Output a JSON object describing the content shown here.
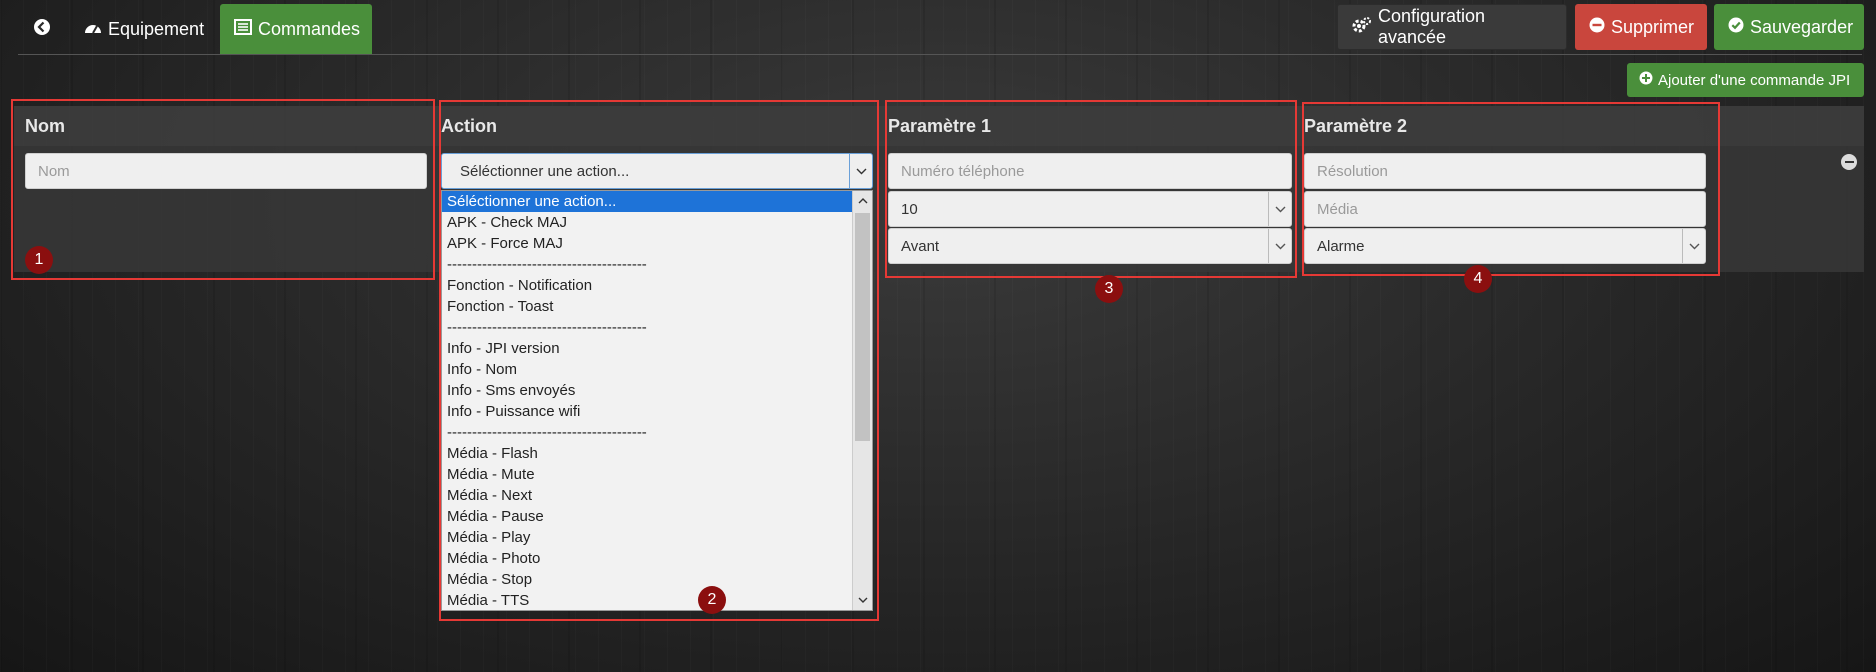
{
  "tabs": {
    "back_icon": "arrow-circle-left-icon",
    "equipement": "Equipement",
    "commandes": "Commandes"
  },
  "toolbar": {
    "config": "Configuration avancée",
    "delete": "Supprimer",
    "save": "Sauvegarder",
    "add_command": "Ajouter d'une commande JPI"
  },
  "columns": {
    "nom": "Nom",
    "action": "Action",
    "param1": "Paramètre 1",
    "param2": "Paramètre 2"
  },
  "nom": {
    "placeholder": "Nom"
  },
  "action": {
    "selected": "Séléctionner une action...",
    "options": [
      "Séléctionner une action...",
      "APK - Check MAJ",
      "APK - Force MAJ",
      "----------------------------------------",
      "Fonction - Notification",
      "Fonction - Toast",
      "----------------------------------------",
      "Info - JPI version",
      "Info - Nom",
      "Info - Sms envoyés",
      "Info - Puissance wifi",
      "----------------------------------------",
      "Média - Flash",
      "Média - Mute",
      "Média - Next",
      "Média - Pause",
      "Média - Play",
      "Média - Photo",
      "Média - Stop",
      "Média - TTS"
    ]
  },
  "param1": {
    "phone_placeholder": "Numéro téléphone",
    "select1": "10",
    "select2": "Avant"
  },
  "param2": {
    "resolution_placeholder": "Résolution",
    "media_placeholder": "Média",
    "select": "Alarme"
  },
  "badges": [
    "1",
    "2",
    "3",
    "4"
  ],
  "colors": {
    "green": "#4a8f3b",
    "red": "#c9463d",
    "annotation": "#e53935",
    "badge": "#8b0f0f",
    "selection": "#1e73d8"
  }
}
